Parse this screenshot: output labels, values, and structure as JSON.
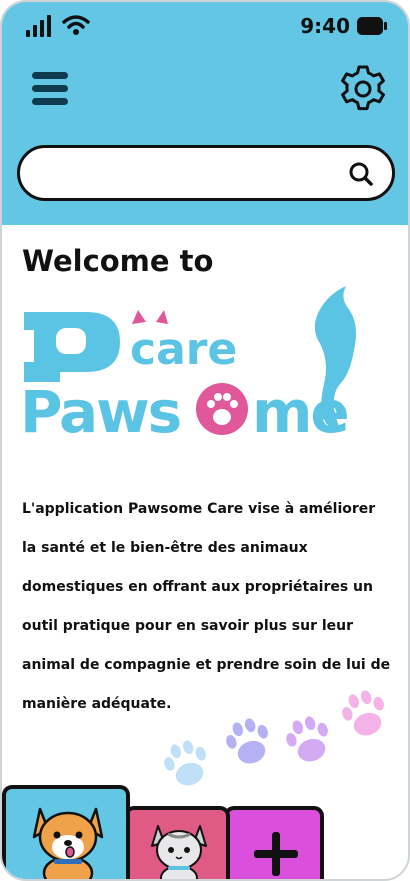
{
  "status_bar": {
    "time": "9:40"
  },
  "header": {
    "search": {
      "value": "",
      "placeholder": ""
    }
  },
  "main": {
    "welcome": "Welcome to",
    "logo": {
      "line1": "care",
      "line2": "Pawsome"
    },
    "description": "L'application Pawsome Care vise à améliorer la santé et le bien-être des animaux domestiques en offrant aux propriétaires un outil pratique pour en savoir plus sur leur animal de compagnie et prendre soin de lui de manière adéquate."
  },
  "colors": {
    "header_bg": "#62c6e4",
    "logo_blue": "#5bc4e5",
    "logo_pink": "#e0579a",
    "tab_dog": "#62c6e4",
    "tab_cat": "#e05a86",
    "tab_add": "#da4fdc"
  },
  "icons": {
    "menu": "hamburger-icon",
    "settings": "gear-icon",
    "search": "search-icon",
    "add": "plus-icon"
  }
}
